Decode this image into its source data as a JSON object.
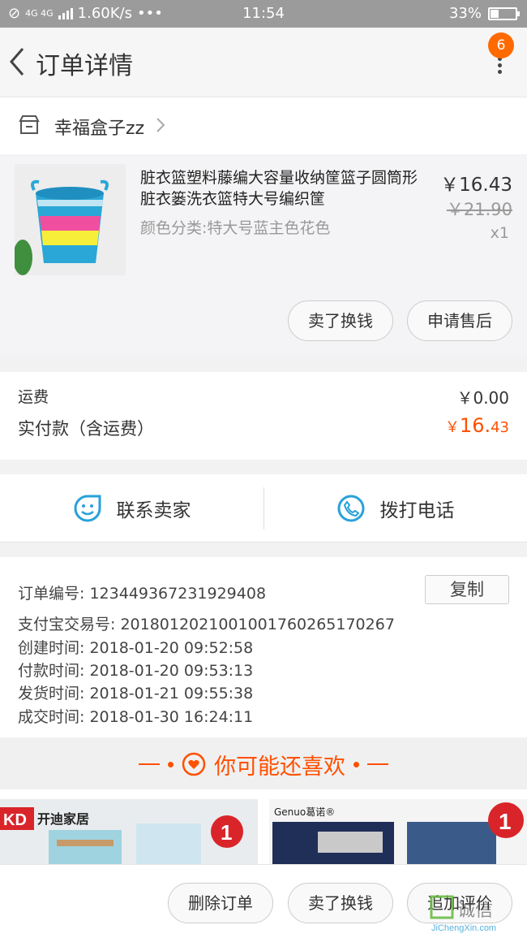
{
  "status_bar": {
    "network": "4G 4G",
    "speed": "1.60K/s",
    "dots": "•••",
    "time": "11:54",
    "battery": "33%",
    "battery_level": 0.33
  },
  "header": {
    "title": "订单详情",
    "badge_count": "6"
  },
  "shop": {
    "name": "幸福盒子zz"
  },
  "product": {
    "title": "脏衣篮塑料藤编大容量收纳筐篮子圆筒形脏衣篓洗衣篮特大号编织筐",
    "spec": "颜色分类:特大号蓝主色花色",
    "price": "￥16.43",
    "original_price": "￥21.90",
    "quantity": "x1",
    "sell_label": "卖了换钱",
    "after_sale_label": "申请售后"
  },
  "fees": {
    "shipping_label": "运费",
    "shipping_value": "￥0.00",
    "total_label": "实付款（含运费）",
    "total_currency": "￥",
    "total_int": "16.",
    "total_dec": "43"
  },
  "contact": {
    "seller_label": "联系卖家",
    "phone_label": "拨打电话"
  },
  "order_info": {
    "order_no": "订单编号:  123449367231929408",
    "alipay_no": "支付宝交易号:  2018012021001001760265170267",
    "created": "创建时间:  2018-01-20 09:52:58",
    "paid": "付款时间:  2018-01-20 09:53:13",
    "shipped": "发货时间:  2018-01-21 09:55:38",
    "completed": "成交时间:  2018-01-30 16:24:11",
    "copy_label": "复制"
  },
  "recommend": {
    "title": "你可能还喜欢",
    "card_a_brand": "开迪家居",
    "card_a_logo": "KD",
    "card_b_brand": "Genuo葛诺®"
  },
  "bottom_bar": {
    "delete_label": "删除订单",
    "sell_label": "卖了换钱",
    "review_label": "追加评价"
  },
  "watermark": {
    "text": "诚信",
    "domain": "JiChengXin.com"
  },
  "colors": {
    "accent": "#ff5000",
    "badge": "#ff6a00",
    "icon_blue": "#29a1d9"
  }
}
